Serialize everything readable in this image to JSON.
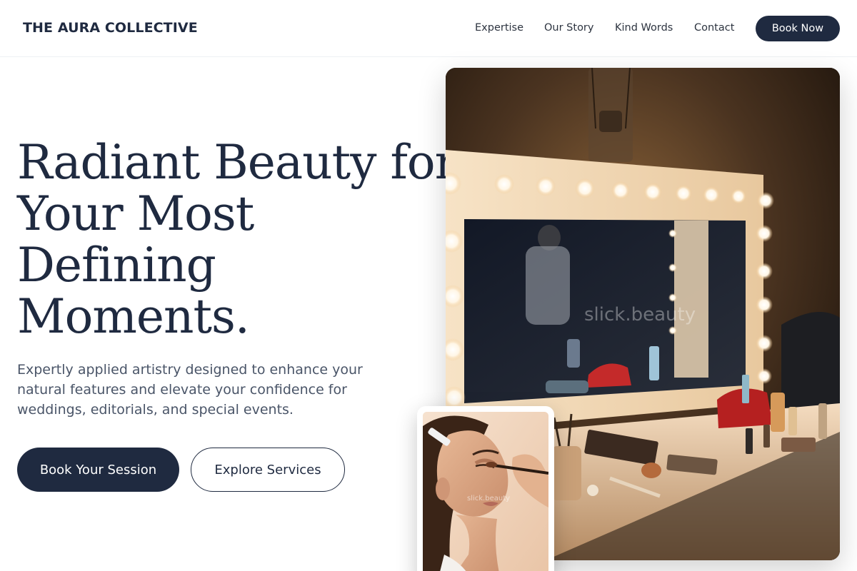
{
  "brand": {
    "name": "THE AURA COLLECTIVE"
  },
  "nav": {
    "links": [
      "Expertise",
      "Our Story",
      "Kind Words",
      "Contact"
    ],
    "cta": "Book Now"
  },
  "hero": {
    "title_lines": [
      "Radiant Beauty for",
      "Your Most",
      "Defining",
      "Moments."
    ],
    "subtitle": "Expertly applied artistry designed to enhance your natural features and elevate your confidence for weddings, editorials, and special events.",
    "primary_button": "Book Your Session",
    "secondary_button": "Explore Services"
  },
  "images": {
    "main_watermark": "slick.beauty",
    "inset_watermark": "slick.beauty"
  },
  "colors": {
    "primary": "#1f2a40",
    "text_muted": "#4a5568",
    "background": "#ffffff"
  }
}
